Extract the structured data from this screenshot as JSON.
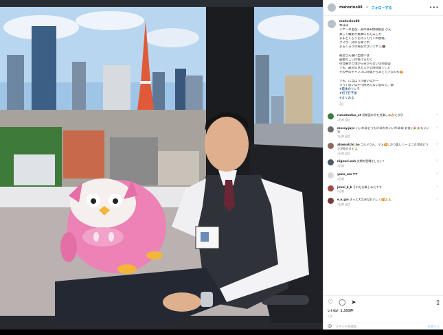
{
  "post": {
    "username": "mahorino88",
    "follow_label": "フォローする",
    "more_icon": "more-horizontal-icon",
    "caption_lines": [
      "本日は",
      "ミヤーな主役・寅の様★無限歓迎 さん",
      "楽しく撮影が無事にもモムした",
      "ままとくろうを持って行くの現場。",
      "クマが、持の写真です。",
      "まるくろうの場を大きいです🐰🐻",
      "",
      "最近さん醤に出会いは",
      "最後のご口の掛けるので",
      "待合乗せた頃から分からないの時間😁",
      "でも、最近の見ガスが全時時間でした",
      "その中のチャンスに時間からあとできるのも🥰",
      "",
      "でも、に当ほうが違いなか～",
      "つって思いながら相見えない思ので。😂"
    ],
    "hashtags": [
      "#最後のリンチ",
      "#何で打不加",
      "#まくみる"
    ],
    "caption_time": "2日",
    "comments": [
      {
        "user": "rumotanfuo_ot",
        "text": "初期面の😍を共楽しみ🔥にき😢",
        "meta": "2日前  返信"
      },
      {
        "user": "messy.jayc",
        "text": "いいわ😂どうも😊😂かわいい😍😂😂 お笑い🎉🎉もいいね",
        "meta": "2日前  返信"
      },
      {
        "user": "ahamatchi_ho",
        "text": "ゴルドさん、マメ🥰しかり楽しく〜 よこれ完成どうさが見たけど🙏",
        "meta": "2日前  返信"
      },
      {
        "user": "nigeuri.ooh",
        "text": "次期の登場をしたい！",
        "meta": "2日前"
      },
      {
        "user": "yuna_sss",
        "text": "❤❤",
        "meta": "2日前"
      },
      {
        "user": "jenni_k_b",
        "text": "それもお楽しみにです",
        "meta": "2日前"
      },
      {
        "user": "e.a_gin",
        "text": "きっと大丈夫なおいしく🥰🙏🙏",
        "meta": "2日前  返信"
      }
    ],
    "likes": "いいね！1,555件",
    "date": "2日",
    "add_comment_placeholder": "コメントを追加...",
    "post_button": "投稿する",
    "icons": {
      "like": "heart-icon",
      "comment": "comment-icon",
      "share": "share-icon",
      "save": "bookmark-icon",
      "emoji": "smile-icon"
    }
  }
}
